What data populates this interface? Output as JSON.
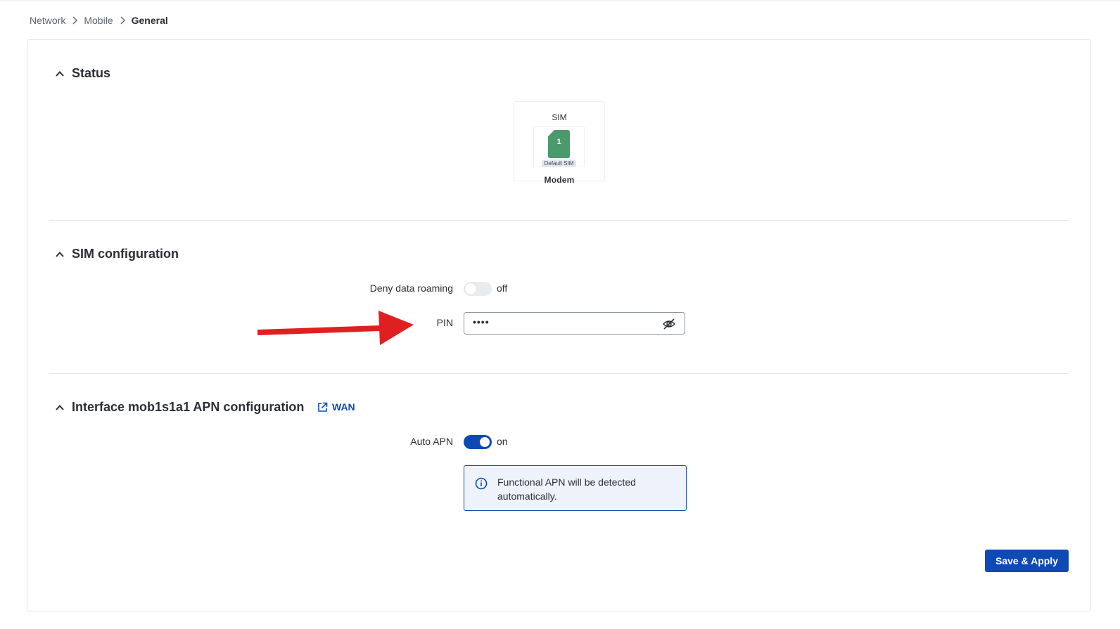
{
  "breadcrumb": {
    "items": [
      "Network",
      "Mobile"
    ],
    "current": "General"
  },
  "status": {
    "title": "Status",
    "sim": {
      "label": "SIM",
      "number": "1",
      "badge": "Default SIM",
      "device": "Modem",
      "color": "#4a9a6c"
    }
  },
  "sim_config": {
    "title": "SIM configuration",
    "deny_roaming": {
      "label": "Deny data roaming",
      "state": "off"
    },
    "pin": {
      "label": "PIN",
      "value": "••••"
    }
  },
  "apn": {
    "title": "Interface mob1s1a1 APN configuration",
    "link": "WAN",
    "auto_apn": {
      "label": "Auto APN",
      "state": "on"
    },
    "info": "Functional APN will be detected automatically."
  },
  "actions": {
    "save_label": "Save & Apply"
  },
  "colors": {
    "primary": "#0e4ab3",
    "annotation_arrow": "#e02020"
  }
}
